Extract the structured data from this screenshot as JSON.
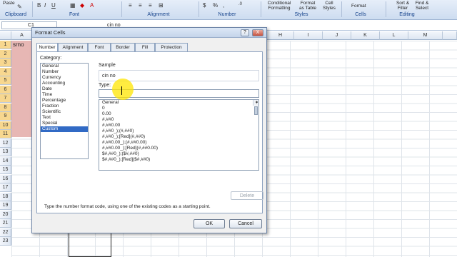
{
  "ribbon": {
    "paste": "Paste",
    "conditional_formatting": "Conditional\nFormatting",
    "format_as_table": "Format\nas Table",
    "cell_styles": "Cell\nStyles",
    "format": "Format",
    "sort_filter": "Sort &\nFilter",
    "find_select": "Find &\nSelect",
    "groups": [
      "Clipboard",
      "Font",
      "Alignment",
      "Number",
      "Styles",
      "Cells",
      "Editing"
    ]
  },
  "formula_bar": {
    "name_box": "C1",
    "fx_value": "cin no"
  },
  "sheet": {
    "columns": [
      "A",
      "H",
      "I",
      "J",
      "K",
      "L",
      "M"
    ],
    "rows": [
      "1",
      "2",
      "3",
      "4",
      "5",
      "6",
      "7",
      "8",
      "9",
      "10",
      "11",
      "12",
      "13",
      "14",
      "15",
      "16",
      "17",
      "18",
      "19",
      "20",
      "21",
      "22",
      "23"
    ],
    "cell_a1": "srno"
  },
  "dialog": {
    "title": "Format Cells",
    "help": "?",
    "close": "X",
    "tabs": [
      "Number",
      "Alignment",
      "Font",
      "Border",
      "Fill",
      "Protection"
    ],
    "category_label": "Category:",
    "categories": [
      "General",
      "Number",
      "Currency",
      "Accounting",
      "Date",
      "Time",
      "Percentage",
      "Fraction",
      "Scientific",
      "Text",
      "Special",
      "Custom"
    ],
    "selected_category": "Custom",
    "sample_label": "Sample",
    "sample_value": "cin no",
    "type_label": "Type:",
    "type_value": "",
    "formats": [
      "General",
      "0",
      "0.00",
      "#,##0",
      "#,##0.00",
      "#,##0_);(#,##0)",
      "#,##0_);[Red](#,##0)",
      "#,##0.00_);(#,##0.00)",
      "#,##0.00_);[Red](#,##0.00)",
      "$#,##0_);($#,##0)",
      "$#,##0_);[Red]($#,##0)"
    ],
    "delete_label": "Delete",
    "hint": "Type the number format code, using one of the existing codes as a starting point.",
    "ok_label": "OK",
    "cancel_label": "Cancel"
  },
  "colors": {
    "accent": "#316ac5",
    "highlight": "#e7b7b4",
    "cursor": "#ffe600"
  }
}
